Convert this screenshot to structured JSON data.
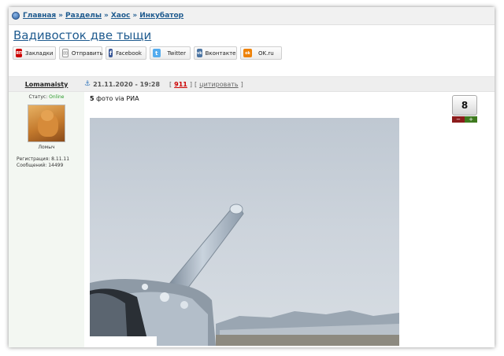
{
  "breadcrumb": {
    "items": [
      "Главная",
      "Разделы",
      "Хаос",
      "Инкубатор"
    ],
    "separator": "»"
  },
  "page": {
    "title": "Вадивосток две тыщи"
  },
  "share": {
    "buttons": [
      {
        "label": "Закладки",
        "icon": "yandex-bookmarks-icon",
        "glyph": "ЯП",
        "color": "#cc0000"
      },
      {
        "label": "Отправить",
        "icon": "envelope-icon",
        "glyph": "✉",
        "color": "#888888"
      },
      {
        "label": "Facebook",
        "icon": "facebook-icon",
        "glyph": "f",
        "color": "#3b5998"
      },
      {
        "label": "Twitter",
        "icon": "twitter-icon",
        "glyph": "t",
        "color": "#55acee"
      },
      {
        "label": "Вконтакте",
        "icon": "vk-icon",
        "glyph": "vk",
        "color": "#4c75a3"
      },
      {
        "label": "OK.ru",
        "icon": "odnoklassniki-icon",
        "glyph": "ok",
        "color": "#ee8208"
      }
    ]
  },
  "post": {
    "author": "Lomamaisty",
    "date": "21.11.2020 - 19:28",
    "number": "911",
    "quote_label": "цитировать",
    "bracket_open": "[",
    "bracket_close": "]",
    "text_bold": "5",
    "text": " фото via РИА",
    "rating": "8",
    "minus": "−",
    "plus": "+"
  },
  "user": {
    "status_label": "Статус:",
    "status_value": "Online",
    "avatar_name": "Ломыч",
    "registration": "Регистрация: 8.11.11",
    "messages": "Сообщений: 14499"
  }
}
